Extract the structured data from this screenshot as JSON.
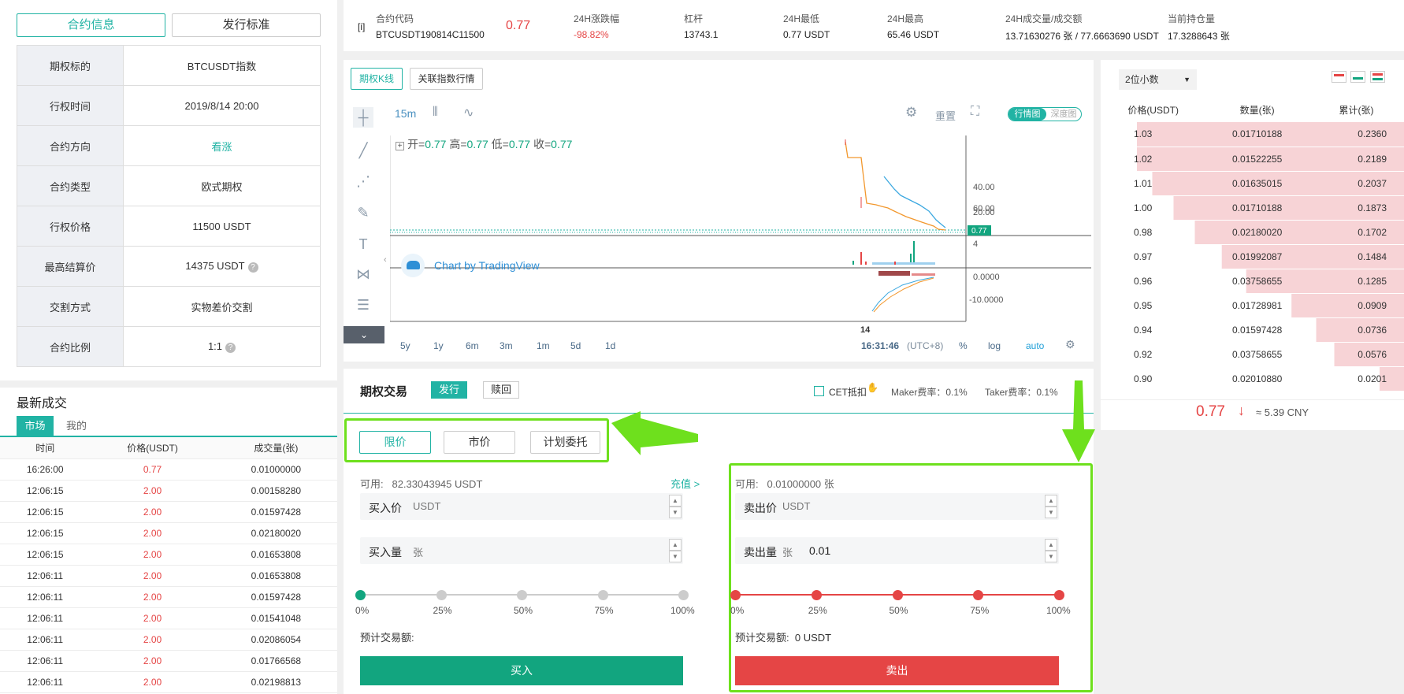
{
  "info": {
    "tabs": [
      "合约信息",
      "发行标准"
    ],
    "rows": [
      {
        "k": "期权标的",
        "v": "BTCUSDT指数",
        "help": false,
        "green": false
      },
      {
        "k": "行权时间",
        "v": "2019/8/14 20:00",
        "help": false,
        "green": false
      },
      {
        "k": "合约方向",
        "v": "看涨",
        "help": false,
        "green": true
      },
      {
        "k": "合约类型",
        "v": "欧式期权",
        "help": false,
        "green": false
      },
      {
        "k": "行权价格",
        "v": "11500 USDT",
        "help": false,
        "green": false
      },
      {
        "k": "最高结算价",
        "v": "14375 USDT",
        "help": true,
        "green": false
      },
      {
        "k": "交割方式",
        "v": "实物差价交割",
        "help": false,
        "green": false
      },
      {
        "k": "合约比例",
        "v": "1:1",
        "help": true,
        "green": false
      }
    ]
  },
  "trades": {
    "title": "最新成交",
    "tabs": [
      "市场",
      "我的"
    ],
    "headers": [
      "时间",
      "价格(USDT)",
      "成交量(张)"
    ],
    "rows": [
      [
        "16:26:00",
        "0.77",
        "0.01000000"
      ],
      [
        "12:06:15",
        "2.00",
        "0.00158280"
      ],
      [
        "12:06:15",
        "2.00",
        "0.01597428"
      ],
      [
        "12:06:15",
        "2.00",
        "0.02180020"
      ],
      [
        "12:06:15",
        "2.00",
        "0.01653808"
      ],
      [
        "12:06:11",
        "2.00",
        "0.01653808"
      ],
      [
        "12:06:11",
        "2.00",
        "0.01597428"
      ],
      [
        "12:06:11",
        "2.00",
        "0.01541048"
      ],
      [
        "12:06:11",
        "2.00",
        "0.02086054"
      ],
      [
        "12:06:11",
        "2.00",
        "0.01766568"
      ],
      [
        "12:06:11",
        "2.00",
        "0.02198813"
      ]
    ]
  },
  "ticker": {
    "info_icon": "[i]",
    "code_label": "合约代码",
    "code": "BTCUSDT190814C11500",
    "price": "0.77",
    "items": [
      {
        "k": "24H涨跌幅",
        "v": "-98.82%",
        "red": true
      },
      {
        "k": "杠杆",
        "v": "13743.1",
        "red": false
      },
      {
        "k": "24H最低",
        "v": "0.77 USDT",
        "red": false
      },
      {
        "k": "24H最高",
        "v": "65.46 USDT",
        "red": false
      },
      {
        "k": "24H成交量/成交额",
        "v": "13.71630276 张 / 77.6663690 USDT",
        "red": false
      },
      {
        "k": "当前持仓量",
        "v": "17.3288643 张",
        "red": false
      }
    ]
  },
  "chart": {
    "tabs": [
      "期权K线",
      "关联指数行情"
    ],
    "interval": "15m",
    "reset": "重置",
    "view_tabs": [
      "行情图",
      "深度图"
    ],
    "ohlc": {
      "open_label": "开=",
      "open": "0.77",
      "high_label": "高=",
      "high": "0.77",
      "low_label": "低=",
      "low": "0.77",
      "close_label": "收=",
      "close": "0.77"
    },
    "yticks": [
      "60.00",
      "40.00",
      "20.00"
    ],
    "price_tag": "0.77",
    "vol_tick": "4",
    "macd_ticks": [
      "0.0000",
      "-10.0000"
    ],
    "xtick": "14",
    "watermark": "Chart by TradingView",
    "ranges": [
      "5y",
      "1y",
      "6m",
      "3m",
      "1m",
      "5d",
      "1d"
    ],
    "time": "16:31:46",
    "tz": "(UTC+8)",
    "opts": [
      "%",
      "log",
      "auto"
    ]
  },
  "book": {
    "decimals": "2位小数",
    "headers": [
      "价格(USDT)",
      "数量(张)",
      "累计(张)"
    ],
    "rows": [
      {
        "p": "1.03",
        "q": "0.01710188",
        "c": "0.2360",
        "depth": 0.88,
        "ask": true
      },
      {
        "p": "1.02",
        "q": "0.01522255",
        "c": "0.2189",
        "depth": 0.88,
        "ask": true
      },
      {
        "p": "1.01",
        "q": "0.01635015",
        "c": "0.2037",
        "depth": 0.83,
        "ask": true
      },
      {
        "p": "1.00",
        "q": "0.01710188",
        "c": "0.1873",
        "depth": 0.76,
        "ask": true
      },
      {
        "p": "0.98",
        "q": "0.02180020",
        "c": "0.1702",
        "depth": 0.69,
        "ask": false
      },
      {
        "p": "0.97",
        "q": "0.01992087",
        "c": "0.1484",
        "depth": 0.6,
        "ask": false
      },
      {
        "p": "0.96",
        "q": "0.03758655",
        "c": "0.1285",
        "depth": 0.52,
        "ask": false
      },
      {
        "p": "0.95",
        "q": "0.01728981",
        "c": "0.0909",
        "depth": 0.37,
        "ask": false
      },
      {
        "p": "0.94",
        "q": "0.01597428",
        "c": "0.0736",
        "depth": 0.29,
        "ask": false
      },
      {
        "p": "0.92",
        "q": "0.03758655",
        "c": "0.0576",
        "depth": 0.23,
        "ask": false
      },
      {
        "p": "0.90",
        "q": "0.02010880",
        "c": "0.0201",
        "depth": 0.08,
        "ask": false
      }
    ],
    "last": "0.77",
    "cny": "≈ 5.39 CNY"
  },
  "trade": {
    "title": "期权交易",
    "mode_tabs": [
      "发行",
      "赎回"
    ],
    "cet": "CET抵扣",
    "maker": "Maker费率：0.1%",
    "taker": "Taker费率：0.1%",
    "order_types": [
      "限价",
      "市价",
      "计划委托"
    ],
    "buy": {
      "avail_label": "可用:",
      "avail": "82.33043945 USDT",
      "deposit": "充值 >",
      "price_label": "买入价",
      "price_unit": "USDT",
      "qty_label": "买入量",
      "qty_unit": "张",
      "est_label": "预计交易额:",
      "est": "",
      "button": "买入"
    },
    "sell": {
      "avail_label": "可用:",
      "avail": "0.01000000 张",
      "price_label": "卖出价",
      "price_unit": "USDT",
      "qty_label": "卖出量",
      "qty_unit": "张",
      "qty_value": "0.01",
      "est_label": "预计交易额:",
      "est": "0 USDT",
      "button": "卖出"
    },
    "pcts": [
      "0%",
      "25%",
      "50%",
      "75%",
      "100%"
    ]
  },
  "colors": {
    "teal": "#21b3a4",
    "red": "#e54545",
    "green": "#12a57f",
    "highlight": "#6ee01d",
    "ask_bg": "#f7d3d6"
  }
}
